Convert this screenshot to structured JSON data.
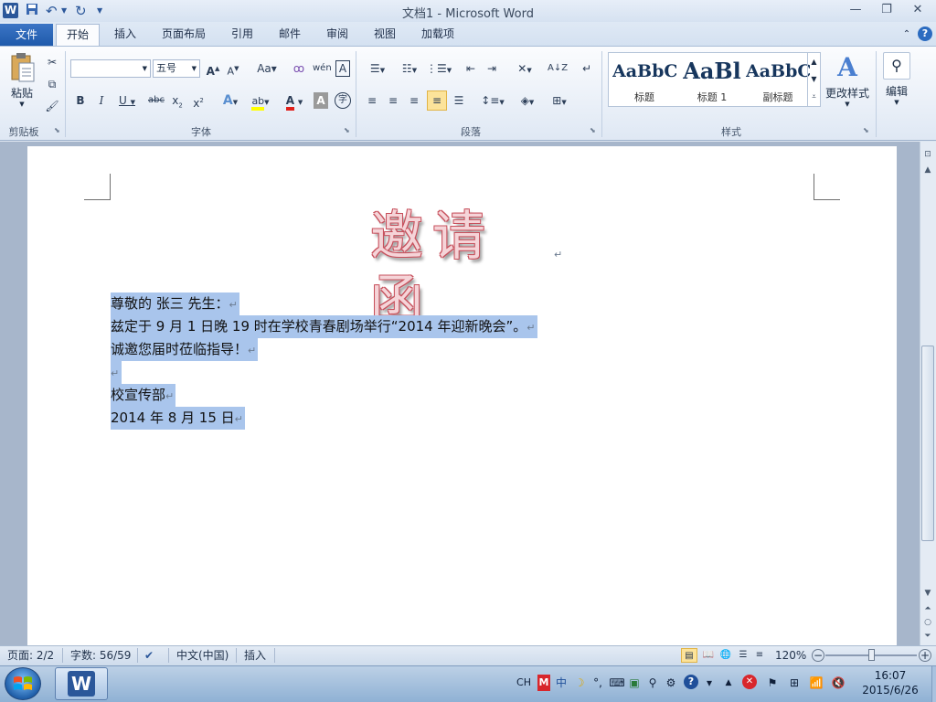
{
  "app": {
    "window_title": "文档1 - Microsoft Word",
    "app_icon_letter": "W"
  },
  "tabs": {
    "file": "文件",
    "home": "开始",
    "insert": "插入",
    "page_layout": "页面布局",
    "references": "引用",
    "mailings": "邮件",
    "review": "审阅",
    "view": "视图",
    "addins": "加载项"
  },
  "ribbon": {
    "clipboard": {
      "paste": "粘贴",
      "label": "剪贴板"
    },
    "font": {
      "name": "",
      "size": "五号",
      "label": "字体"
    },
    "paragraph": {
      "label": "段落"
    },
    "styles": {
      "label": "样式",
      "items": [
        {
          "preview": "AaBbC",
          "name": "标题"
        },
        {
          "preview": "AaBl",
          "name": "标题 1"
        },
        {
          "preview": "AaBbC",
          "name": "副标题"
        }
      ],
      "change_styles": "更改样式"
    },
    "editing": {
      "label": "编辑"
    }
  },
  "document": {
    "heading": "邀请函",
    "lines": [
      "尊敬的  张三  先生：",
      "兹定于 9 月 1 日晚 19 时在学校青春剧场举行“2014 年迎新晚会”。",
      "诚邀您届时莅临指导！",
      "",
      "校宣传部",
      "2014 年 8 月 15 日"
    ],
    "paragraph_mark": "↵"
  },
  "status": {
    "page": "页面: 2/2",
    "words": "字数: 56/59",
    "language": "中文(中国)",
    "mode": "插入",
    "zoom": "120%",
    "zoom_fraction": 0.5
  },
  "taskbar": {
    "ime": "CH",
    "time": "16:07",
    "date": "2015/6/26"
  },
  "colors": {
    "selection": "#a9c5ec",
    "file_tab": "#2b66b5",
    "heading_fill": "#f5d4d8",
    "heading_outline": "#c7505c"
  }
}
